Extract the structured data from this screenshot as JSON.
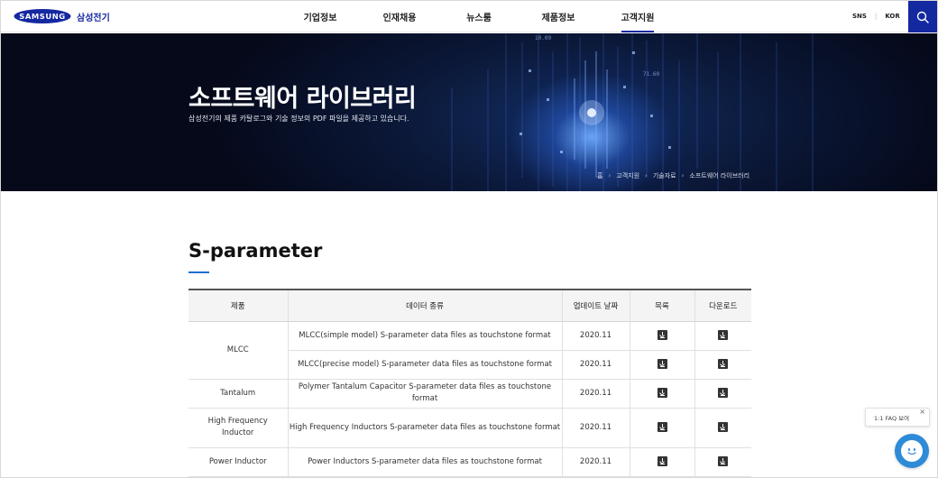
{
  "header": {
    "logo_text": "SAMSUNG",
    "logo_sub": "삼성전기",
    "nav": [
      {
        "label": "기업정보"
      },
      {
        "label": "인재채용"
      },
      {
        "label": "뉴스룸"
      },
      {
        "label": "제품정보"
      },
      {
        "label": "고객지원",
        "active": true
      }
    ],
    "util": {
      "sns": "SNS",
      "lang": "KOR"
    },
    "search_icon": "search-icon"
  },
  "hero": {
    "title": "소프트웨어 라이브러리",
    "description": "삼성전기의 제품 카탈로그와 기술 정보의 PDF 파일을 제공하고 있습니다.",
    "breadcrumb": [
      "홈",
      "고객지원",
      "기술자료",
      "소프트웨어 라이브러리"
    ],
    "overlay_numbers": [
      "10.09",
      "71.60"
    ]
  },
  "section": {
    "title": "S-parameter",
    "table": {
      "headers": [
        "제품",
        "데이터 종류",
        "업데이트 날짜",
        "목록",
        "다운로드"
      ],
      "rows": [
        {
          "product": "MLCC",
          "type": "MLCC(simple model) S-parameter data files as touchstone format",
          "date": "2020.11"
        },
        {
          "product": "",
          "type": "MLCC(precise model) S-parameter data files as touchstone format",
          "date": "2020.11"
        },
        {
          "product": "Tantalum",
          "type": "Polymer Tantalum Capacitor S-parameter data files as touchstone format",
          "date": "2020.11"
        },
        {
          "product": "High Frequency Inductor",
          "type": "High Frequency Inductors S-parameter data files as touchstone format",
          "date": "2020.11"
        },
        {
          "product": "Power Inductor",
          "type": "Power Inductors S-parameter data files as touchstone format",
          "date": "2020.11"
        }
      ]
    }
  },
  "floating": {
    "faq_label": "1:1 FAQ 보여",
    "faq_close": "×"
  },
  "colors": {
    "brand": "#1428a0",
    "accent_bar": "#1e6fd0",
    "chatbot": "#2d8bd8"
  }
}
